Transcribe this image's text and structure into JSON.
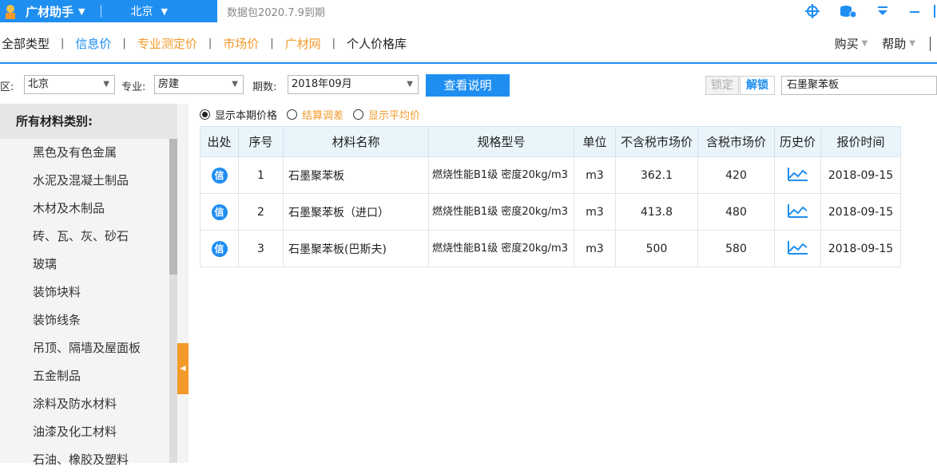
{
  "titlebar": {
    "app_name": "广材助手",
    "city": "北京",
    "expire_text": "数据包2020.7.9到期"
  },
  "nav": {
    "all_types": "全部类型",
    "info_price": "信息价",
    "pro_price": "专业测定价",
    "market_price": "市场价",
    "gcw": "广材网",
    "personal": "个人价格库",
    "buy": "购买",
    "help": "帮助"
  },
  "filters": {
    "region_label": "区:",
    "region_value": "北京",
    "major_label": "专业:",
    "major_value": "房建",
    "period_label": "期数:",
    "period_value": "2018年09月",
    "view_button": "查看说明",
    "lock_button": "锁定",
    "unlock_button": "解锁",
    "search_value": "石墨聚苯板"
  },
  "sidebar": {
    "header": "所有材料类别:",
    "items": [
      "黑色及有色金属",
      "水泥及混凝土制品",
      "木材及木制品",
      "砖、瓦、灰、砂石",
      "玻璃",
      "装饰块料",
      "装饰线条",
      "吊顶、隔墙及屋面板",
      "五金制品",
      "涂料及防水材料",
      "油漆及化工材料",
      "石油、橡胶及塑料"
    ]
  },
  "radios": {
    "current": "显示本期价格",
    "settlement": "结算调差",
    "average": "显示平均价"
  },
  "table": {
    "headers": [
      "出处",
      "序号",
      "材料名称",
      "规格型号",
      "单位",
      "不含税市场价",
      "含税市场价",
      "历史价",
      "报价时间"
    ],
    "rows": [
      {
        "source": "信",
        "no": "1",
        "name": "石墨聚苯板",
        "spec": "燃烧性能B1级 密度20kg/m3",
        "unit": "m3",
        "price_ex": "362.1",
        "price_in": "420",
        "date": "2018-09-15"
      },
      {
        "source": "信",
        "no": "2",
        "name": "石墨聚苯板（进口）",
        "spec": "燃烧性能B1级 密度20kg/m3",
        "unit": "m3",
        "price_ex": "413.8",
        "price_in": "480",
        "date": "2018-09-15"
      },
      {
        "source": "信",
        "no": "3",
        "name": "石墨聚苯板(巴斯夫)",
        "spec": "燃烧性能B1级 密度20kg/m3",
        "unit": "m3",
        "price_ex": "500",
        "price_in": "580",
        "date": "2018-09-15"
      }
    ]
  },
  "colors": {
    "accent": "#1f8ef1",
    "orange": "#f39a2b"
  }
}
